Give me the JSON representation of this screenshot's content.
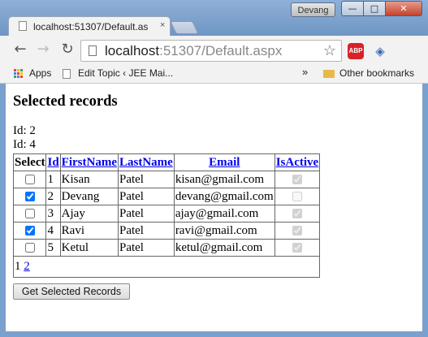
{
  "titlebar": {
    "user": "Devang"
  },
  "tab": {
    "title": "localhost:51307/Default.as",
    "close_glyph": "×"
  },
  "window_controls": {
    "min": "—",
    "max": "□",
    "close": "✕"
  },
  "toolbar": {
    "back_glyph": "←",
    "forward_glyph": "→",
    "reload_glyph": "↻",
    "url_host": "localhost",
    "url_path": ":51307/Default.aspx",
    "star_glyph": "☆",
    "abp_label": "ABP",
    "menu_glyph": "≡"
  },
  "bookmarks": {
    "apps": "Apps",
    "edit_topic": "Edit Topic ‹ JEE Mai...",
    "more": "»",
    "other": "Other bookmarks"
  },
  "page": {
    "heading": "Selected records",
    "selected_ids": [
      "Id: 2",
      "Id: 4"
    ],
    "columns": [
      "Select",
      "Id",
      "FirstName",
      "LastName",
      "Email",
      "IsActive"
    ],
    "rows": [
      {
        "selected": false,
        "id": "1",
        "first": "Kisan",
        "last": "Patel",
        "email": "kisan@gmail.com",
        "active": true
      },
      {
        "selected": true,
        "id": "2",
        "first": "Devang",
        "last": "Patel",
        "email": "devang@gmail.com",
        "active": false
      },
      {
        "selected": false,
        "id": "3",
        "first": "Ajay",
        "last": "Patel",
        "email": "ajay@gmail.com",
        "active": true
      },
      {
        "selected": true,
        "id": "4",
        "first": "Ravi",
        "last": "Patel",
        "email": "ravi@gmail.com",
        "active": true
      },
      {
        "selected": false,
        "id": "5",
        "first": "Ketul",
        "last": "Patel",
        "email": "ketul@gmail.com",
        "active": true
      }
    ],
    "pager": {
      "current": "1",
      "next": "2"
    },
    "button_label": "Get Selected Records"
  },
  "colors": {
    "frame": "#7aa0cd",
    "link": "#0000ee",
    "abp": "#d8222a"
  }
}
